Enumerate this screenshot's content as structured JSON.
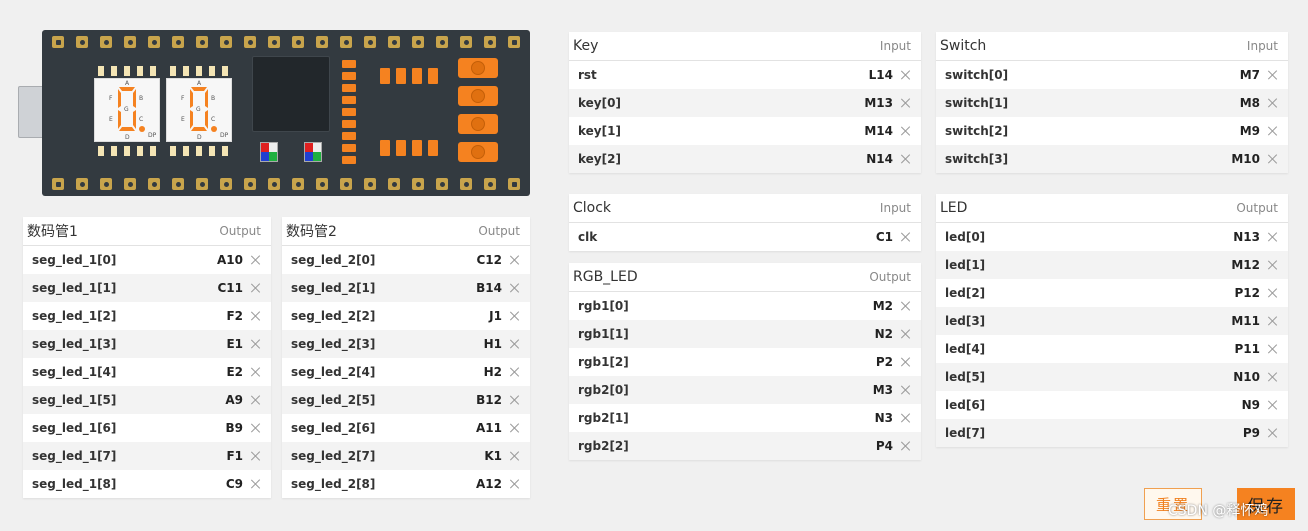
{
  "board": {
    "segment_letters": [
      "A",
      "B",
      "C",
      "D",
      "E",
      "F",
      "G",
      "DP"
    ],
    "colors": {
      "pcb": "#333a40",
      "pad": "#c8a44c",
      "accent": "#f58220"
    }
  },
  "tables": {
    "seg1": {
      "title": "数码管1",
      "type": "Output",
      "rows": [
        {
          "name": "seg_led_1[0]",
          "pin": "A10"
        },
        {
          "name": "seg_led_1[1]",
          "pin": "C11"
        },
        {
          "name": "seg_led_1[2]",
          "pin": "F2"
        },
        {
          "name": "seg_led_1[3]",
          "pin": "E1"
        },
        {
          "name": "seg_led_1[4]",
          "pin": "E2"
        },
        {
          "name": "seg_led_1[5]",
          "pin": "A9"
        },
        {
          "name": "seg_led_1[6]",
          "pin": "B9"
        },
        {
          "name": "seg_led_1[7]",
          "pin": "F1"
        },
        {
          "name": "seg_led_1[8]",
          "pin": "C9"
        }
      ]
    },
    "seg2": {
      "title": "数码管2",
      "type": "Output",
      "rows": [
        {
          "name": "seg_led_2[0]",
          "pin": "C12"
        },
        {
          "name": "seg_led_2[1]",
          "pin": "B14"
        },
        {
          "name": "seg_led_2[2]",
          "pin": "J1"
        },
        {
          "name": "seg_led_2[3]",
          "pin": "H1"
        },
        {
          "name": "seg_led_2[4]",
          "pin": "H2"
        },
        {
          "name": "seg_led_2[5]",
          "pin": "B12"
        },
        {
          "name": "seg_led_2[6]",
          "pin": "A11"
        },
        {
          "name": "seg_led_2[7]",
          "pin": "K1"
        },
        {
          "name": "seg_led_2[8]",
          "pin": "A12"
        }
      ]
    },
    "key": {
      "title": "Key",
      "type": "Input",
      "rows": [
        {
          "name": "rst",
          "pin": "L14"
        },
        {
          "name": "key[0]",
          "pin": "M13"
        },
        {
          "name": "key[1]",
          "pin": "M14"
        },
        {
          "name": "key[2]",
          "pin": "N14"
        }
      ]
    },
    "clock": {
      "title": "Clock",
      "type": "Input",
      "rows": [
        {
          "name": "clk",
          "pin": "C1"
        }
      ]
    },
    "rgb": {
      "title": "RGB_LED",
      "type": "Output",
      "rows": [
        {
          "name": "rgb1[0]",
          "pin": "M2"
        },
        {
          "name": "rgb1[1]",
          "pin": "N2"
        },
        {
          "name": "rgb1[2]",
          "pin": "P2"
        },
        {
          "name": "rgb2[0]",
          "pin": "M3"
        },
        {
          "name": "rgb2[1]",
          "pin": "N3"
        },
        {
          "name": "rgb2[2]",
          "pin": "P4"
        }
      ]
    },
    "switch": {
      "title": "Switch",
      "type": "Input",
      "rows": [
        {
          "name": "switch[0]",
          "pin": "M7"
        },
        {
          "name": "switch[1]",
          "pin": "M8"
        },
        {
          "name": "switch[2]",
          "pin": "M9"
        },
        {
          "name": "switch[3]",
          "pin": "M10"
        }
      ]
    },
    "led": {
      "title": "LED",
      "type": "Output",
      "rows": [
        {
          "name": "led[0]",
          "pin": "N13"
        },
        {
          "name": "led[1]",
          "pin": "M12"
        },
        {
          "name": "led[2]",
          "pin": "P12"
        },
        {
          "name": "led[3]",
          "pin": "M11"
        },
        {
          "name": "led[4]",
          "pin": "P11"
        },
        {
          "name": "led[5]",
          "pin": "N10"
        },
        {
          "name": "led[6]",
          "pin": "N9"
        },
        {
          "name": "led[7]",
          "pin": "P9"
        }
      ]
    }
  },
  "actions": {
    "reset_label": "重置",
    "save_label": "保存"
  },
  "watermark": "CSDN @释怀鸡"
}
